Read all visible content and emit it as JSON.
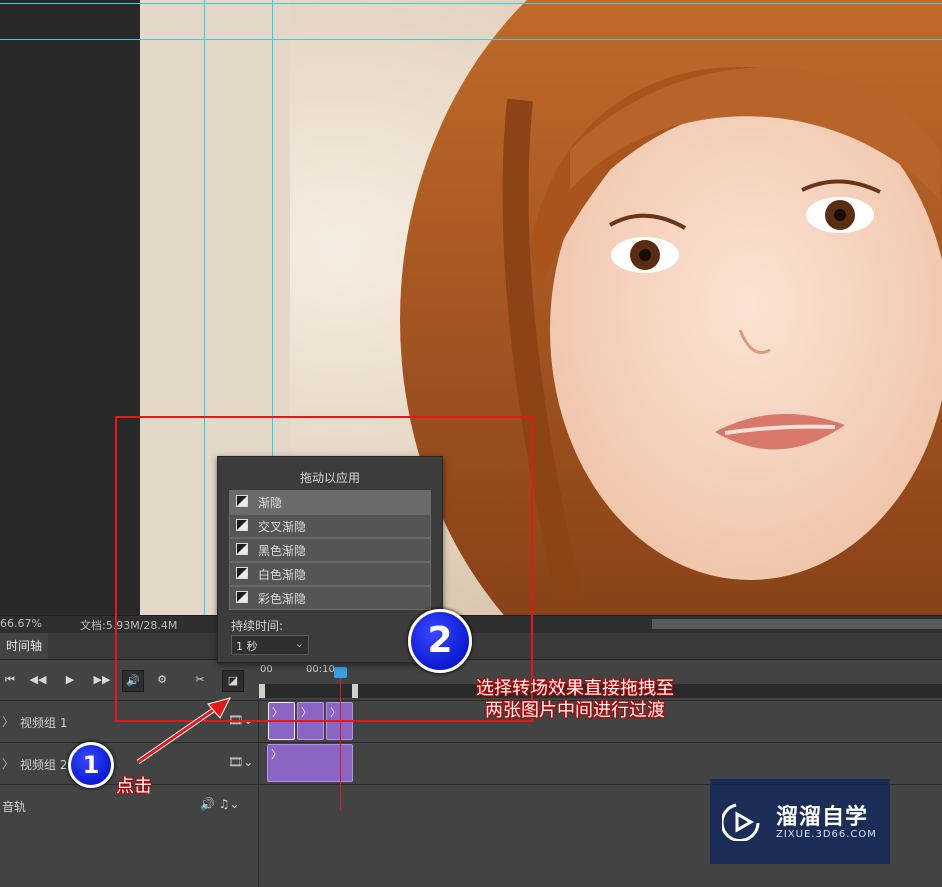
{
  "status": {
    "zoom": "66.67%",
    "doc_info": "文档:5.93M/28.4M"
  },
  "timeline": {
    "tab_label": "时间轴",
    "time_zero": "00",
    "time_mark": "00:10",
    "tracks": [
      {
        "label": "视频组 1"
      },
      {
        "label": "视频组 2"
      },
      {
        "label": "音轨"
      }
    ]
  },
  "popup": {
    "title": "拖动以应用",
    "items": [
      "渐隐",
      "交叉渐隐",
      "黑色渐隐",
      "白色渐隐",
      "彩色渐隐"
    ],
    "selected_index": 0,
    "duration_label": "持续时间:",
    "duration_value": "1 秒"
  },
  "annotations": {
    "badge_1": "1",
    "badge_2": "2",
    "click_hint": "点击",
    "instruction_line1": "选择转场效果直接拖拽至",
    "instruction_line2": "两张图片中间进行过渡"
  },
  "watermark": {
    "title": "溜溜自学",
    "subtitle": "ZIXUE.3D66.COM"
  },
  "colors": {
    "annotation_red": "#e01a1a",
    "clip_purple": "#8a65c3",
    "guide_cyan": "#35d0e6",
    "playhead": "#d42020"
  }
}
